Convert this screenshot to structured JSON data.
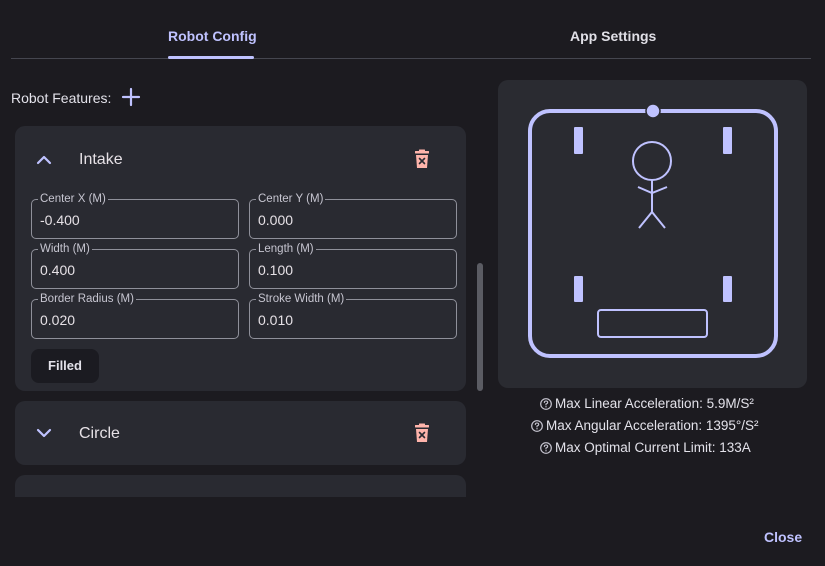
{
  "tabs": [
    {
      "label": "Robot Config",
      "active": true
    },
    {
      "label": "App Settings",
      "active": false
    }
  ],
  "features": {
    "label": "Robot Features:",
    "add_icon": "plus-icon"
  },
  "cards": {
    "intake": {
      "title": "Intake",
      "expanded": true,
      "fields": {
        "center_x": {
          "label": "Center X (M)",
          "value": "-0.400"
        },
        "center_y": {
          "label": "Center Y (M)",
          "value": "0.000"
        },
        "width": {
          "label": "Width (M)",
          "value": "0.400"
        },
        "length": {
          "label": "Length (M)",
          "value": "0.100"
        },
        "border_radius": {
          "label": "Border Radius (M)",
          "value": "0.020"
        },
        "stroke_width": {
          "label": "Stroke Width (M)",
          "value": "0.010"
        }
      },
      "filled_label": "Filled"
    },
    "circle": {
      "title": "Circle",
      "expanded": false
    }
  },
  "stats": [
    {
      "text": "Max Linear Acceleration: 5.9M/S²",
      "icon": "help-circle-icon"
    },
    {
      "text": "Max Angular Acceleration: 1395°/S²",
      "icon": "help-circle-icon"
    },
    {
      "text": "Max Optimal Current Limit: 133A",
      "icon": "help-circle-icon"
    }
  ],
  "close_label": "Close",
  "colors": {
    "accent": "#bfc2ff",
    "delete": "#ffb4ab",
    "background": "#1c1b20",
    "card": "#292a31"
  }
}
